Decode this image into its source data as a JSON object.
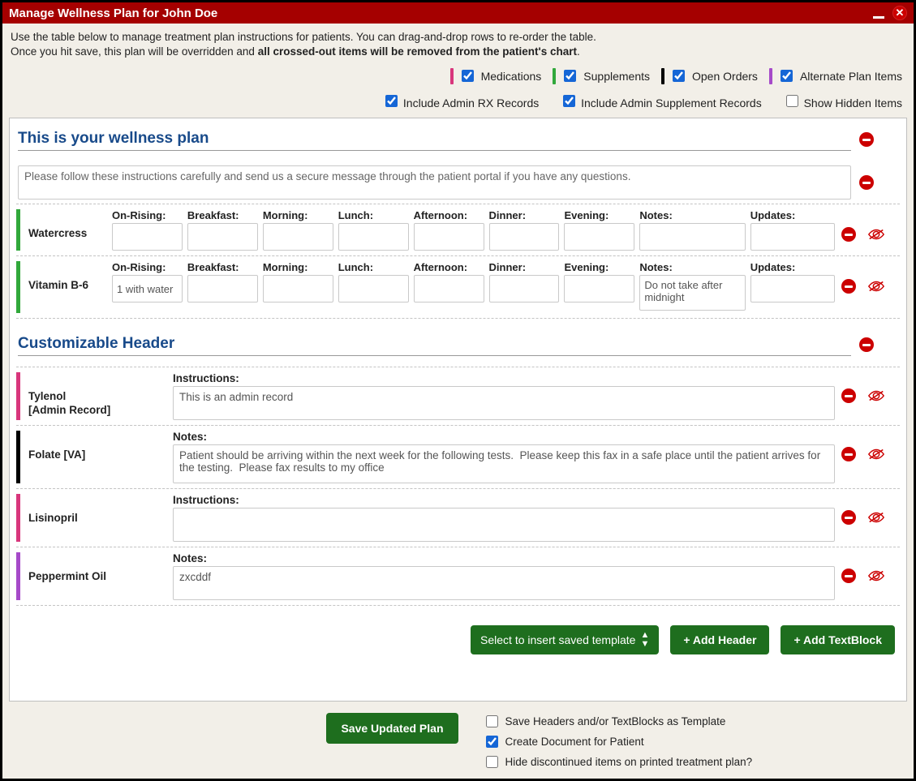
{
  "window_title": "Manage Wellness Plan for John Doe",
  "intro": {
    "line1": "Use the table below to manage treatment plan instructions for patients. You can drag-and-drop rows to re-order the table.",
    "line2a": "Once you hit save, this plan will be overridden and ",
    "line2b": "all crossed-out items will be removed from the patient's chart",
    "line2c": "."
  },
  "filters": {
    "medications": "Medications",
    "supplements": "Supplements",
    "open_orders": "Open Orders",
    "alternate": "Alternate Plan Items",
    "include_rx": "Include Admin RX Records",
    "include_supp": "Include Admin Supplement Records",
    "show_hidden": "Show Hidden Items"
  },
  "dose_labels": {
    "on_rising": "On-Rising:",
    "breakfast": "Breakfast:",
    "morning": "Morning:",
    "lunch": "Lunch:",
    "afternoon": "Afternoon:",
    "dinner": "Dinner:",
    "evening": "Evening:",
    "notes": "Notes:",
    "updates": "Updates:",
    "instructions": "Instructions:"
  },
  "sections": {
    "header1": "This is your wellness plan",
    "textblock1": "Please follow these instructions carefully and send us a secure message through the patient portal if you have any questions.",
    "header2": "Customizable Header"
  },
  "items": {
    "watercress": {
      "name": "Watercress",
      "on_rising": "",
      "breakfast": "",
      "morning": "",
      "lunch": "",
      "afternoon": "",
      "dinner": "",
      "evening": "",
      "notes": "",
      "updates": ""
    },
    "vitamin_b6": {
      "name": "Vitamin B-6",
      "on_rising": "1 with water",
      "breakfast": "",
      "morning": "",
      "lunch": "",
      "afternoon": "",
      "dinner": "",
      "evening": "",
      "notes": "Do not take after midnight",
      "updates": ""
    },
    "tylenol": {
      "name": "Tylenol",
      "sub": "[Admin Record]",
      "instructions": "This is an admin record"
    },
    "folate": {
      "name": "Folate [VA]",
      "notes": "Patient should be arriving within the next week for the following tests.  Please keep this fax in a safe place until the patient arrives for the testing.  Please fax results to my office"
    },
    "lisinopril": {
      "name": "Lisinopril",
      "instructions": ""
    },
    "peppermint": {
      "name": "Peppermint Oil",
      "notes": "zxcddf"
    }
  },
  "buttons": {
    "select_template": "Select to insert saved template",
    "add_header": "+ Add Header",
    "add_textblock": "+ Add TextBlock",
    "save": "Save Updated Plan"
  },
  "footer_opts": {
    "save_template": "Save Headers and/or TextBlocks as Template",
    "create_doc": "Create Document for Patient",
    "hide_disc": "Hide discontinued items on printed treatment plan?"
  }
}
